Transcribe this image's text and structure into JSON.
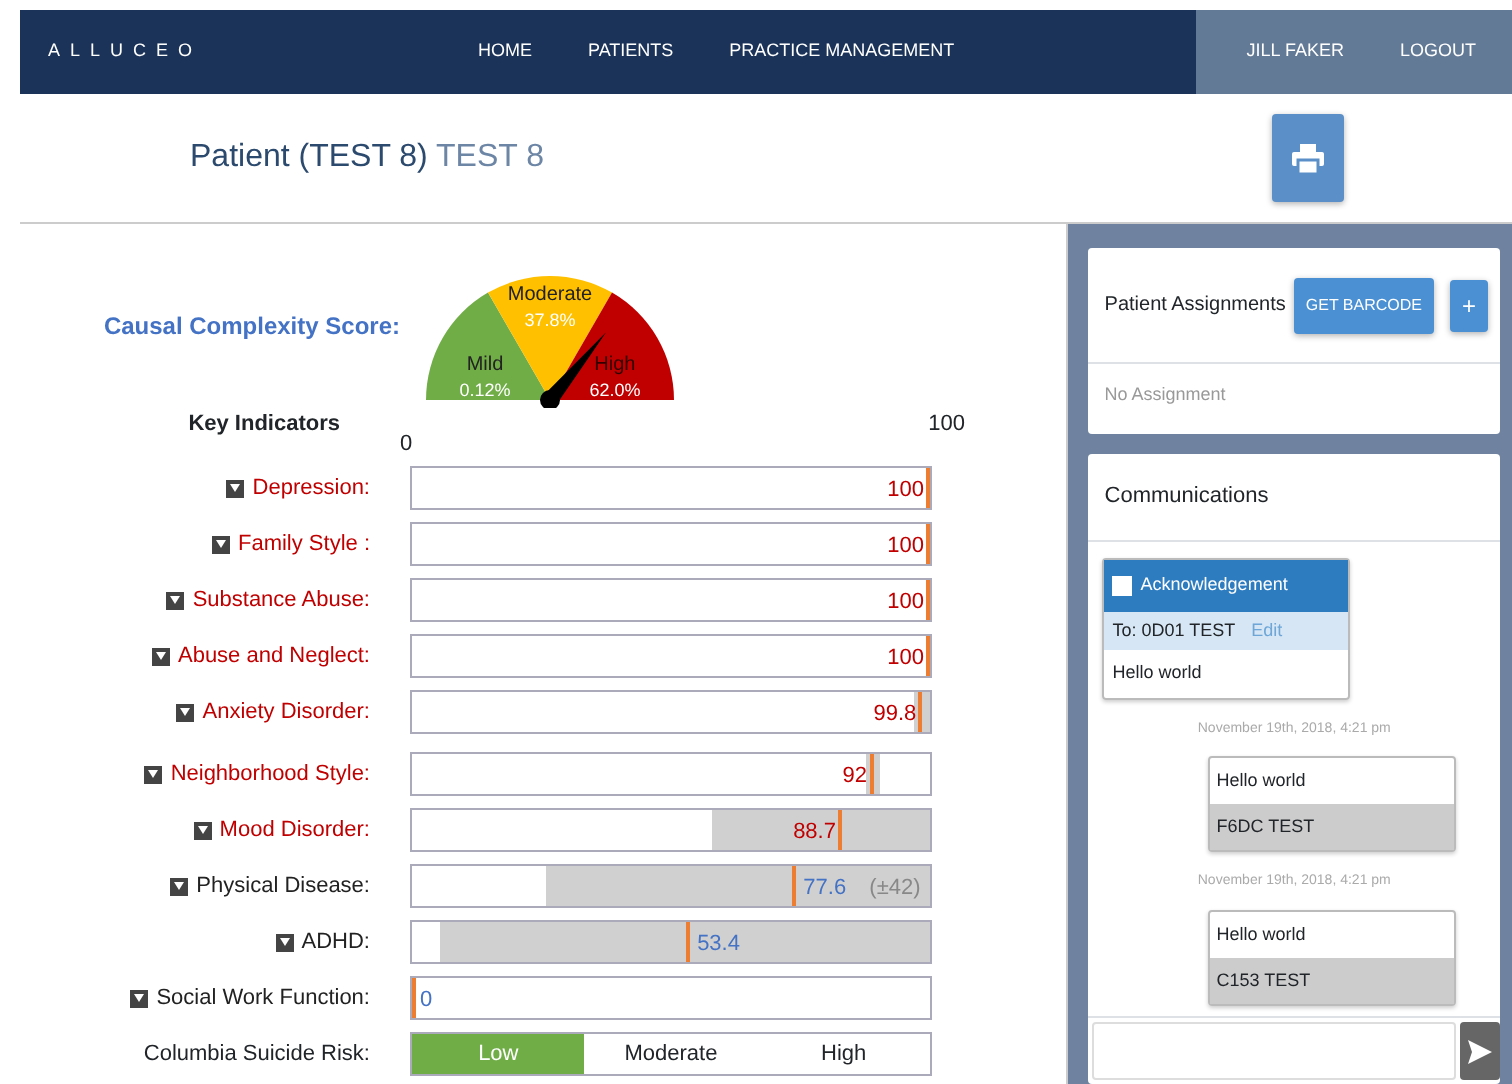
{
  "navbar": {
    "brand": "ALLUCEO",
    "links": [
      {
        "label": "HOME"
      },
      {
        "label": "PATIENTS"
      },
      {
        "label": "PRACTICE MANAGEMENT"
      }
    ],
    "user": "JILL FAKER",
    "logout": "LOGOUT"
  },
  "header": {
    "title": "Patient (TEST 8)",
    "subtitle": "TEST 8"
  },
  "score": {
    "label": "Causal Complexity Score:",
    "segments": [
      {
        "name": "Mild",
        "value": "0.12%",
        "color": "#70ad47"
      },
      {
        "name": "Moderate",
        "value": "37.8%",
        "color": "#ffc000"
      },
      {
        "name": "High",
        "value": "62.0%",
        "color": "#c00000"
      }
    ]
  },
  "indicators": {
    "title": "Key Indicators",
    "axis_min": "0",
    "axis_max": "100",
    "rows": [
      {
        "label": "Depression:",
        "flagged": true,
        "value": "100",
        "level": 1.0
      },
      {
        "label": "Family Style :",
        "flagged": true,
        "value": "100",
        "level": 1.0
      },
      {
        "label": "Substance Abuse:",
        "flagged": true,
        "value": "100",
        "level": 1.0
      },
      {
        "label": "Abuse and Neglect:",
        "flagged": true,
        "value": "100",
        "level": 1.0
      },
      {
        "label": "Anxiety Disorder:",
        "flagged": true,
        "value": "99.8",
        "level": 0.985
      },
      {
        "label": "Neighborhood Style:",
        "flagged": true,
        "value": "92",
        "level": 0.89
      },
      {
        "label": "Mood Disorder:",
        "flagged": true,
        "value": "88.7",
        "level": 0.83
      },
      {
        "label": "Physical Disease:",
        "flagged": false,
        "value": "77.6",
        "note": "(±42)",
        "level": 0.74
      },
      {
        "label": "ADHD:",
        "flagged": false,
        "value": "53.4",
        "level": 0.535
      },
      {
        "label": "Social Work Function:",
        "flagged": false,
        "value": "0",
        "level": 0.0
      }
    ]
  },
  "suicide_risk": {
    "label": "Columbia Suicide Risk:",
    "options": [
      {
        "label": "Low",
        "selected": true
      },
      {
        "label": "Moderate",
        "selected": false
      },
      {
        "label": "High",
        "selected": false
      }
    ]
  },
  "assignments": {
    "title": "Patient Assignments",
    "barcode_button": "GET BARCODE",
    "add_button": "+",
    "empty": "No Assignment"
  },
  "communications": {
    "title": "Communications",
    "messages": [
      {
        "kind": "task",
        "title": "Acknowledgement",
        "checked": false,
        "to": "To: 0D01 TEST",
        "edit": "Edit",
        "body": "Hello world"
      },
      {
        "kind": "note",
        "time": "November 19th, 2018, 4:21 pm",
        "body": "Hello world",
        "author": "F6DC TEST"
      },
      {
        "kind": "note",
        "time": "November 19th, 2018, 4:21 pm",
        "body": "Hello world",
        "author": "C153 TEST"
      }
    ]
  }
}
